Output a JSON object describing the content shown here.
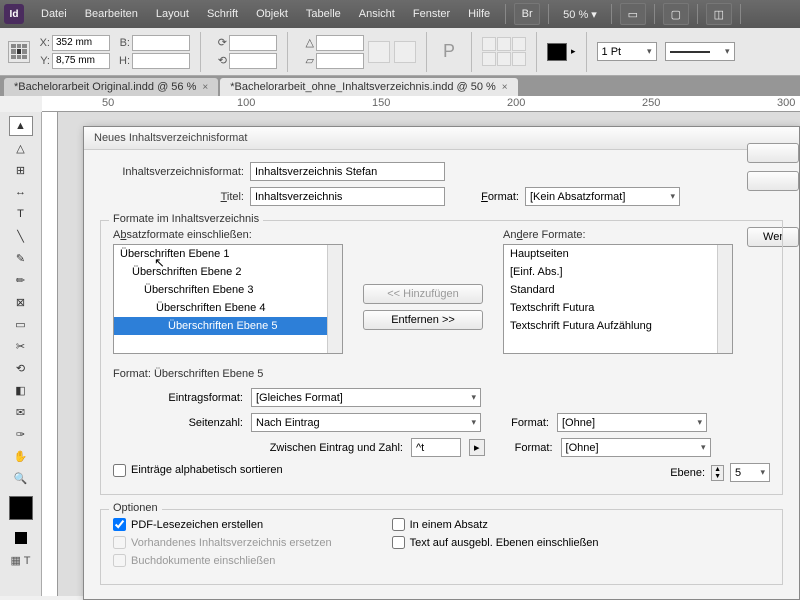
{
  "menubar": {
    "items": [
      "Datei",
      "Bearbeiten",
      "Layout",
      "Schrift",
      "Objekt",
      "Tabelle",
      "Ansicht",
      "Fenster",
      "Hilfe"
    ],
    "br": "Br",
    "zoom": "50 %"
  },
  "toolbar": {
    "x_label": "X:",
    "x": "352 mm",
    "y_label": "Y:",
    "y": "8,75 mm",
    "b_label": "B:",
    "b": "",
    "h_label": "H:",
    "h": "",
    "stroke": "1 Pt"
  },
  "tabs": [
    {
      "label": "*Bachelorarbeit Original.indd @ 56 %",
      "active": false
    },
    {
      "label": "*Bachelorarbeit_ohne_Inhaltsverzeichnis.indd @ 50 %",
      "active": true
    }
  ],
  "ruler": [
    "50",
    "100",
    "150",
    "200",
    "250",
    "300"
  ],
  "dialog": {
    "title": "Neues Inhaltsverzeichnisformat",
    "format_label": "Inhaltsverzeichnisformat:",
    "format_value": "Inhaltsverzeichnis Stefan",
    "title_label": "Titel:",
    "title_value": "Inhaltsverzeichnis",
    "dropdown_format_label": "Format:",
    "dropdown_format_value": "[Kein Absatzformat]",
    "fieldset1": "Formate im Inhaltsverzeichnis",
    "include_label_pre": "A",
    "include_label_u": "b",
    "include_label_post": "satzformate einschließen:",
    "other_label_pre": "An",
    "other_label_u": "d",
    "other_label_post": "ere Formate:",
    "include_list": [
      "Überschriften Ebene 1",
      "Überschriften Ebene 2",
      "Überschriften Ebene 3",
      "Überschriften Ebene 4",
      "Überschriften Ebene 5"
    ],
    "include_selected": 4,
    "other_list": [
      "Hauptseiten",
      "[Einf. Abs.]",
      "Standard",
      "Textschrift Futura",
      "Textschrift Futura Aufzählung"
    ],
    "add_btn": "<< Hinzufügen",
    "remove_btn": "Entfernen >>",
    "section_format": "Format: Überschriften Ebene 5",
    "entry_format_label": "Eintragsformat:",
    "entry_format_value": "[Gleiches Format]",
    "page_num_label": "Seitenzahl:",
    "page_num_value": "Nach Eintrag",
    "between_label": "Zwischen Eintrag und Zahl:",
    "between_value": "^t",
    "format2_label": "Format:",
    "format2_value": "[Ohne]",
    "format3_value": "[Ohne]",
    "level_label": "Ebene:",
    "level_value": "5",
    "sort_alpha": "Einträge alphabetisch sortieren",
    "options_label": "Optionen",
    "opt_pdf": "PDF-Lesezeichen erstellen",
    "opt_replace": "Vorhandenes Inhaltsverzeichnis ersetzen",
    "opt_book": "Buchdokumente einschließen",
    "opt_paragraph": "In einem Absatz",
    "opt_hidden": "Text auf ausgebl. Ebenen einschließen",
    "fewer_btn": "Wer"
  }
}
